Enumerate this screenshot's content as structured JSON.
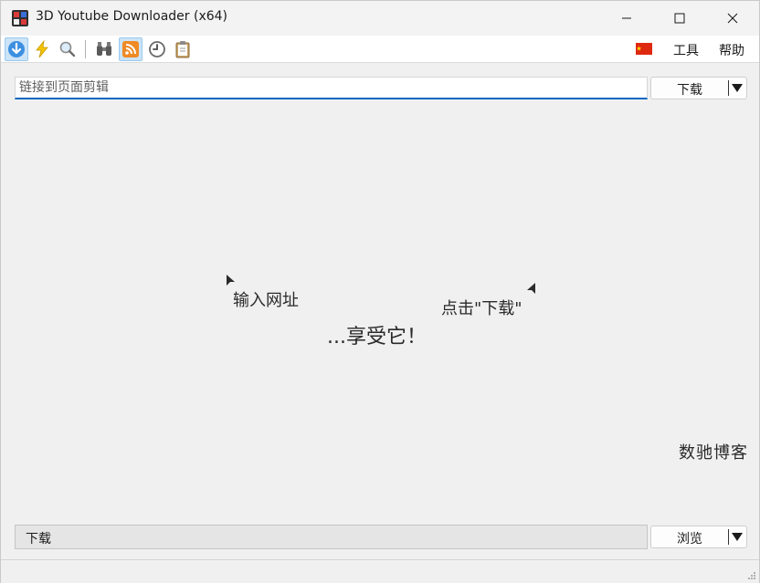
{
  "window": {
    "title": "3D Youtube Downloader (x64)"
  },
  "toolbar": {
    "buttons": [
      {
        "name": "download",
        "icon": "download-arrow-icon",
        "active": true
      },
      {
        "name": "quick",
        "icon": "lightning-icon",
        "active": false
      },
      {
        "name": "search",
        "icon": "magnifier-icon",
        "active": false
      },
      {
        "name": "binoculars",
        "icon": "binoculars-icon",
        "active": false
      },
      {
        "name": "rss",
        "icon": "rss-feed-icon",
        "active": true
      },
      {
        "name": "history",
        "icon": "clock-icon",
        "active": false
      },
      {
        "name": "clipboard",
        "icon": "clipboard-icon",
        "active": false
      }
    ],
    "menu": {
      "tools": "工具",
      "help": "帮助"
    },
    "language_flag": "china-flag-icon"
  },
  "url_bar": {
    "placeholder": "链接到页面剪辑",
    "value": ""
  },
  "download_button": {
    "label": "下载"
  },
  "hints": {
    "enter_url": "输入网址",
    "click_download": "点击\"下载\"",
    "enjoy": "...享受它！"
  },
  "watermark": "数驰博客",
  "output": {
    "path_value": "下载",
    "browse_label": "浏览"
  },
  "colors": {
    "accent": "#0067c0",
    "toolbar_active": "#cce4f7",
    "flag_red": "#de2910"
  }
}
